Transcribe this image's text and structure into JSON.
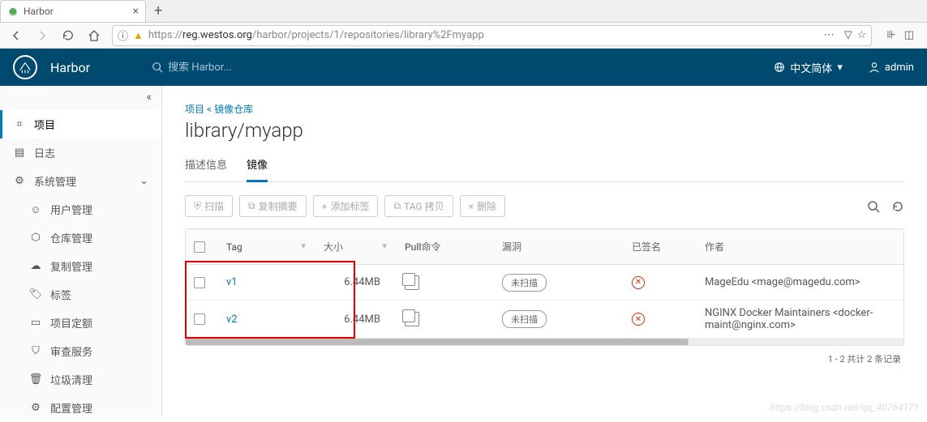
{
  "browser": {
    "tab_title": "Harbor",
    "url_prefix": "https://",
    "url_host": "reg.westos.org",
    "url_path": "/harbor/projects/1/repositories/library%2Fmyapp"
  },
  "header": {
    "app_name": "Harbor",
    "search_placeholder": "搜索 Harbor...",
    "language": "中文简体",
    "user": "admin"
  },
  "sidebar": {
    "items": [
      {
        "label": "项目",
        "icon": "projects"
      },
      {
        "label": "日志",
        "icon": "logs"
      },
      {
        "label": "系统管理",
        "icon": "admin",
        "expandable": true
      }
    ],
    "sub_items": [
      {
        "label": "用户管理"
      },
      {
        "label": "仓库管理"
      },
      {
        "label": "复制管理"
      },
      {
        "label": "标签"
      },
      {
        "label": "项目定额"
      },
      {
        "label": "审查服务"
      },
      {
        "label": "垃圾清理"
      },
      {
        "label": "配置管理"
      }
    ]
  },
  "breadcrumb": {
    "project": "项目",
    "sep": "<",
    "repo": "镜像仓库"
  },
  "page_title": "library/myapp",
  "subtabs": [
    {
      "label": "描述信息"
    },
    {
      "label": "镜像",
      "active": true
    }
  ],
  "toolbar": {
    "scan": "扫描",
    "copy_digest": "复制摘要",
    "add_labels": "添加标签",
    "tag_copy": "TAG 拷贝",
    "delete": "删除"
  },
  "columns": {
    "tag": "Tag",
    "size": "大小",
    "pull": "Pull命令",
    "vuln": "漏洞",
    "signed": "已签名",
    "author": "作者"
  },
  "rows": [
    {
      "tag": "v1",
      "size": "6.44MB",
      "vuln": "未扫描",
      "signed": false,
      "author": "MageEdu <mage@magedu.com>"
    },
    {
      "tag": "v2",
      "size": "6.44MB",
      "vuln": "未扫描",
      "signed": false,
      "author": "NGINX Docker Maintainers <docker-maint@nginx.com>"
    }
  ],
  "pager": "1 - 2 共计 2 条记录",
  "watermark": "https://blog.csdn.net/qq_40764171"
}
